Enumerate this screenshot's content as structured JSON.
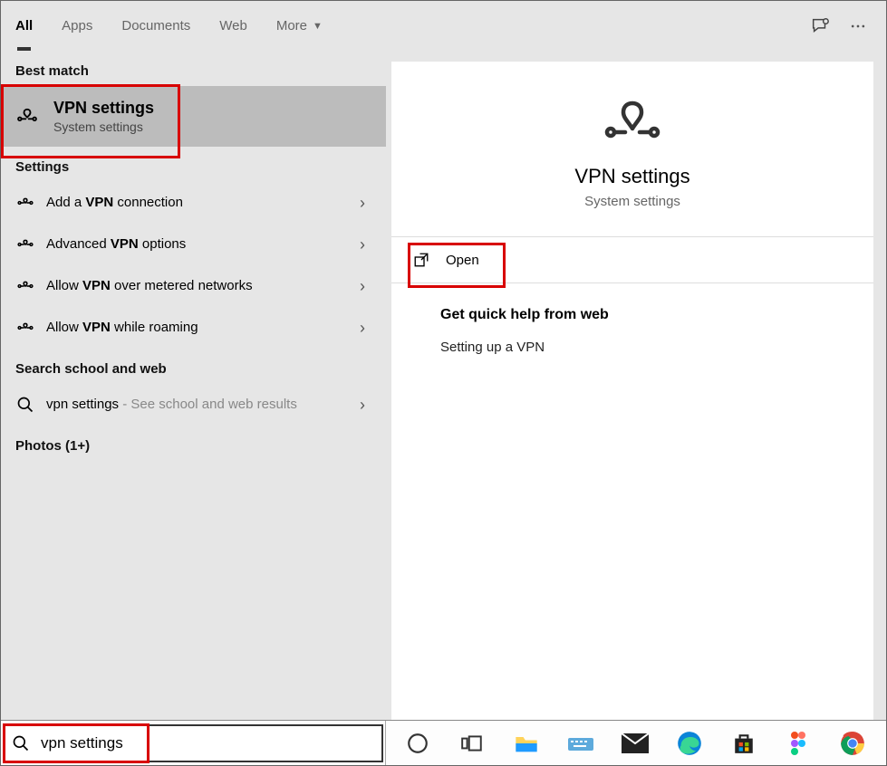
{
  "topbar": {
    "tabs": [
      {
        "label": "All",
        "active": true
      },
      {
        "label": "Apps",
        "active": false
      },
      {
        "label": "Documents",
        "active": false
      },
      {
        "label": "Web",
        "active": false
      },
      {
        "label": "More",
        "active": false,
        "dropdown": true
      }
    ]
  },
  "left": {
    "best_match_header": "Best match",
    "best_match": {
      "title": "VPN settings",
      "subtitle": "System settings"
    },
    "settings_header": "Settings",
    "settings_items": [
      {
        "prefix": "Add a ",
        "bold": "VPN",
        "suffix": " connection"
      },
      {
        "prefix": "Advanced ",
        "bold": "VPN",
        "suffix": " options"
      },
      {
        "prefix": "Allow ",
        "bold": "VPN",
        "suffix": " over metered networks"
      },
      {
        "prefix": "Allow ",
        "bold": "VPN",
        "suffix": " while roaming"
      }
    ],
    "search_web_header": "Search school and web",
    "search_web": {
      "query": "vpn settings",
      "suffix": " - See school and web results"
    },
    "photos_header": "Photos (1+)"
  },
  "right": {
    "title": "VPN settings",
    "subtitle": "System settings",
    "open_label": "Open",
    "quickhelp_header": "Get quick help from web",
    "quickhelp_link": "Setting up a VPN"
  },
  "taskbar": {
    "search_value": "vpn settings",
    "icons": [
      "cortana",
      "task-view",
      "file-explorer",
      "keyboard",
      "mail",
      "edge",
      "microsoft-store",
      "figma",
      "chrome"
    ]
  }
}
